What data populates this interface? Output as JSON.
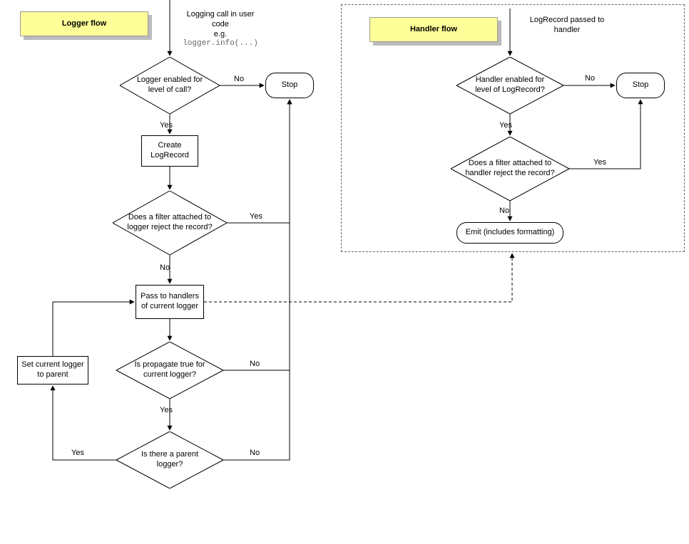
{
  "titles": {
    "logger": "Logger flow",
    "handler": "Handler flow"
  },
  "logger": {
    "entry_line1": "Logging call in user",
    "entry_line2": "code",
    "entry_line3": "e.g.",
    "entry_code": "logger.info(...)",
    "decision1": "Logger enabled for level of call?",
    "stop": "Stop",
    "process1": "Create LogRecord",
    "decision2": "Does a filter attached to logger reject the record?",
    "process2": "Pass to handlers of current logger",
    "decision3": "Is propagate true for current logger?",
    "decision4": "Is there a parent logger?",
    "process3": "Set current logger to parent"
  },
  "handler": {
    "entry": "LogRecord passed to handler",
    "decision1": "Handler enabled for level of LogRecord?",
    "stop": "Stop",
    "decision2": "Does a filter attached to handler reject the record?",
    "term": "Emit (includes formatting)"
  },
  "labels": {
    "yes": "Yes",
    "no": "No"
  }
}
